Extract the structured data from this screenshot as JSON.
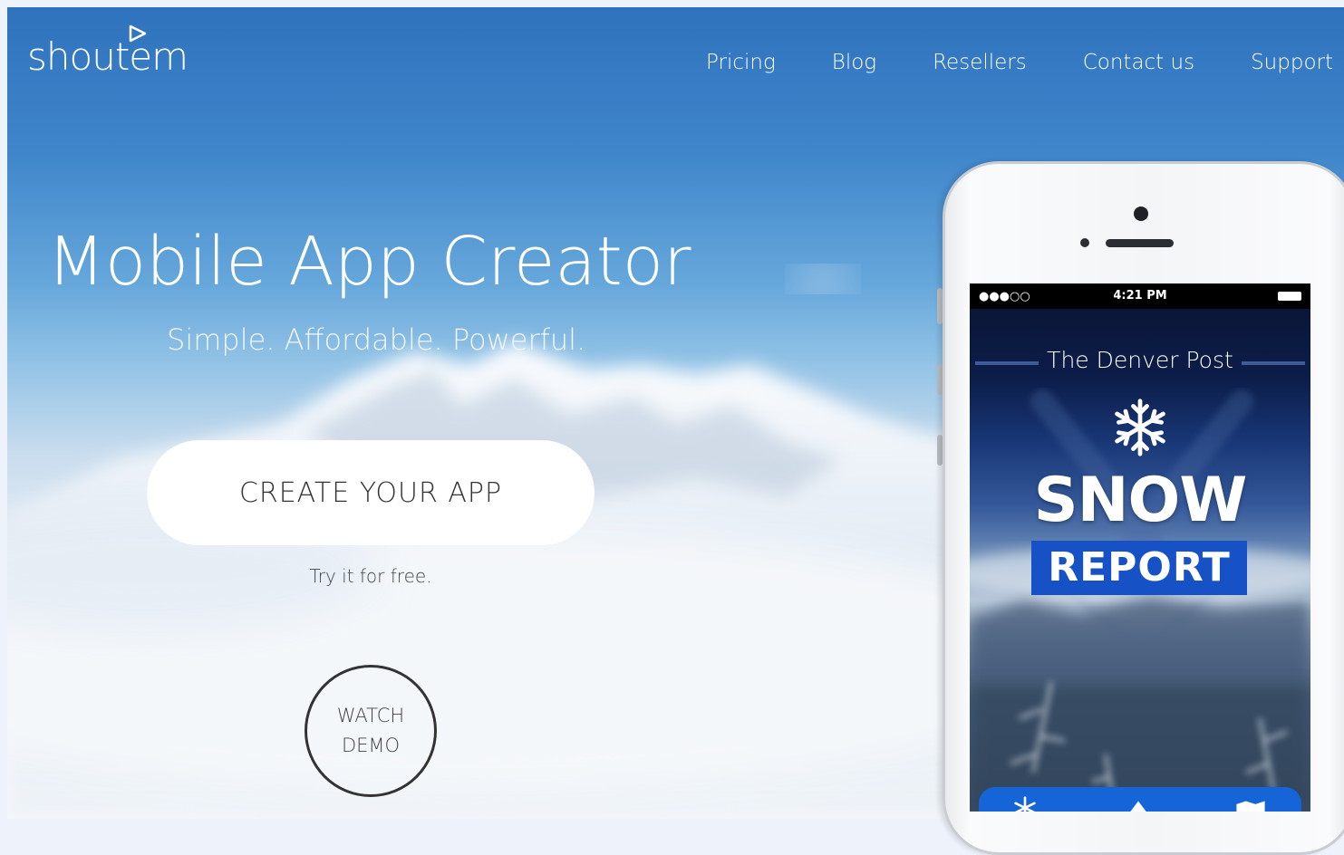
{
  "brand": {
    "logo_text": "shoutem"
  },
  "nav": {
    "items": [
      {
        "label": "Pricing"
      },
      {
        "label": "Blog"
      },
      {
        "label": "Resellers"
      },
      {
        "label": "Contact us"
      },
      {
        "label": "Support"
      }
    ]
  },
  "hero": {
    "title": "Mobile App Creator",
    "subtitle": "Simple. Affordable. Powerful.",
    "cta_label": "CREATE YOUR APP",
    "cta_note": "Try it for free.",
    "watch_line1": "WATCH",
    "watch_line2": "DEMO"
  },
  "phone": {
    "status_time": "4:21 PM",
    "status_signal": "●●●○○",
    "app_title": "The Denver Post",
    "headline_top": "SNOW",
    "headline_bottom": "REPORT",
    "snowflake_icon": "snowflake-icon"
  },
  "colors": {
    "sky_top": "#2f72bd",
    "cta_bg": "#ffffff",
    "report_bg": "#1652c5",
    "tabbar_bg": "#1565d8"
  }
}
